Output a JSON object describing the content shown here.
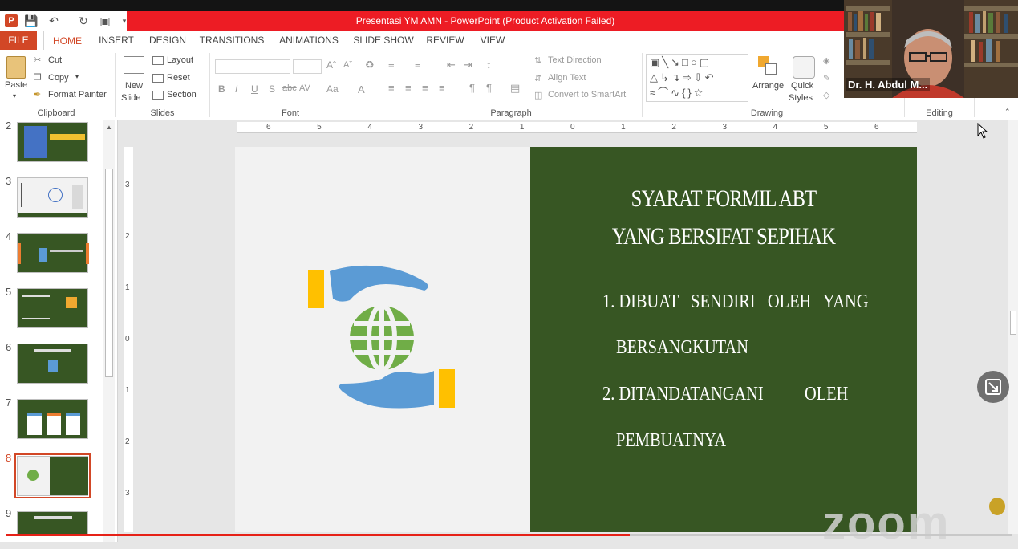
{
  "window": {
    "title": "Presentasi YM AMN  -  PowerPoint (Product Activation Failed)"
  },
  "tabs": [
    {
      "label": "FILE"
    },
    {
      "label": "HOME"
    },
    {
      "label": "INSERT"
    },
    {
      "label": "DESIGN"
    },
    {
      "label": "TRANSITIONS"
    },
    {
      "label": "ANIMATIONS"
    },
    {
      "label": "SLIDE SHOW"
    },
    {
      "label": "REVIEW"
    },
    {
      "label": "VIEW"
    }
  ],
  "ribbon": {
    "clipboard": {
      "paste": "Paste",
      "cut": "Cut",
      "copy": "Copy",
      "format_painter": "Format Painter",
      "group": "Clipboard"
    },
    "slides": {
      "new_slide_1": "New",
      "new_slide_2": "Slide",
      "layout": "Layout",
      "reset": "Reset",
      "section": "Section",
      "group": "Slides"
    },
    "font": {
      "group": "Font"
    },
    "paragraph": {
      "text_direction": "Text Direction",
      "align_text": "Align Text",
      "smartart": "Convert to SmartArt",
      "group": "Paragraph"
    },
    "drawing": {
      "arrange": "Arrange",
      "quick_1": "Quick",
      "quick_2": "Styles",
      "group": "Drawing"
    },
    "editing": {
      "group": "Editing"
    }
  },
  "slide_pane": {
    "thumbnails": [
      {
        "num": "2"
      },
      {
        "num": "3"
      },
      {
        "num": "4"
      },
      {
        "num": "5"
      },
      {
        "num": "6"
      },
      {
        "num": "7"
      },
      {
        "num": "8"
      },
      {
        "num": "9"
      }
    ],
    "selected": "8"
  },
  "ruler": {
    "h": [
      "6",
      "5",
      "4",
      "3",
      "2",
      "1",
      "0",
      "1",
      "2",
      "3",
      "4",
      "5",
      "6"
    ],
    "v": [
      "3",
      "2",
      "1",
      "0",
      "1",
      "2",
      "3"
    ]
  },
  "slide": {
    "title_1": "SYARAT FORMIL  ABT",
    "title_2": "YANG BERSIFAT SEPIHAK",
    "item_1a": "1. DIBUAT   SENDIRI   OLEH   YANG",
    "item_1b": "BERSANGKUTAN",
    "item_2a": "2. DITANDATANGANI",
    "item_2b": "OLEH",
    "item_2c": "PEMBUATNYA"
  },
  "webcam": {
    "name": "Dr. H. Abdul M..."
  },
  "watermark": "zoom",
  "playback": {
    "progress": 0.62
  },
  "colors": {
    "accent": "#d24726",
    "title_bar": "#ed1c24",
    "slide_green": "#375623",
    "icon_blue": "#5b9bd5",
    "icon_green": "#70ad47",
    "icon_yellow": "#ffc000"
  }
}
